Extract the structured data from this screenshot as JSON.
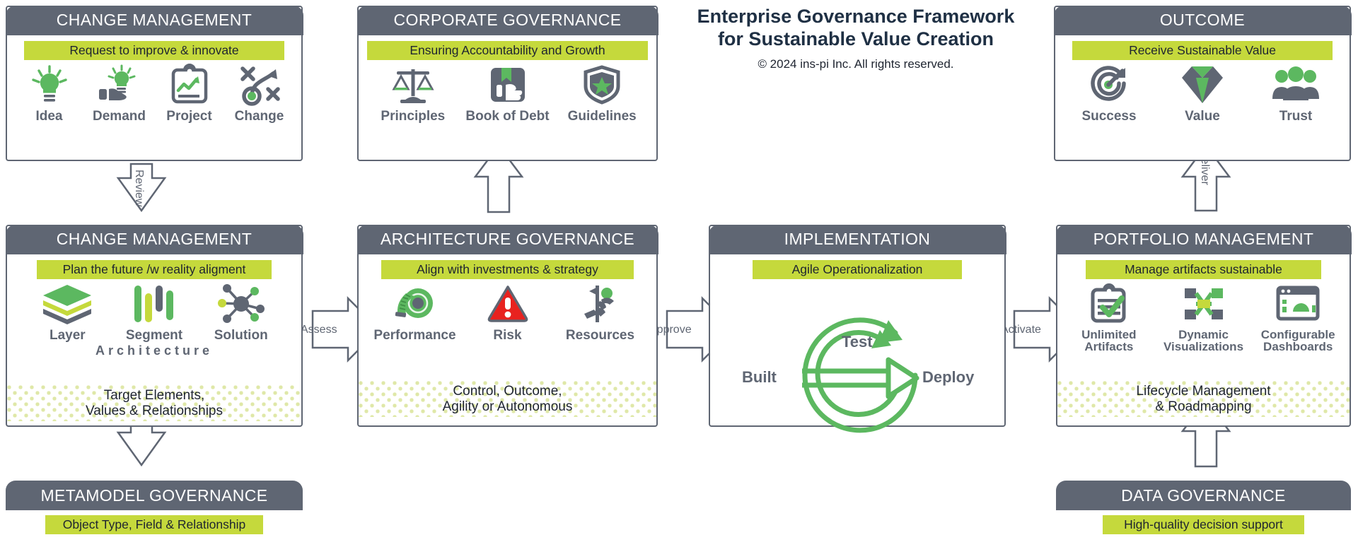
{
  "title": {
    "line1": "Enterprise Governance Framework",
    "line2": "for Sustainable Value Creation",
    "copyright": "© 2024 ins-pi Inc. All rights reserved."
  },
  "colors": {
    "slate": "#5f6673",
    "lime": "#c5d93c",
    "green": "#5cb860",
    "red": "#e8221f",
    "navy": "#1f3044",
    "dots": "#dfe8a8"
  },
  "cards": {
    "change_management_top": {
      "header": "CHANGE MANAGEMENT",
      "subtitle": "Request to improve & innovate",
      "icons": [
        {
          "label": "Idea",
          "icon": "lightbulb-icon"
        },
        {
          "label": "Demand",
          "icon": "hand-bulb-icon"
        },
        {
          "label": "Project",
          "icon": "clipboard-chart-icon"
        },
        {
          "label": "Change",
          "icon": "change-path-icon"
        }
      ]
    },
    "corporate_governance": {
      "header": "CORPORATE GOVERNANCE",
      "subtitle": "Ensuring Accountability and Growth",
      "icons": [
        {
          "label": "Principles",
          "icon": "scales-icon"
        },
        {
          "label": "Book of Debt",
          "icon": "book-thumb-icon"
        },
        {
          "label": "Guidelines",
          "icon": "shield-star-icon"
        }
      ]
    },
    "outcome": {
      "header": "OUTCOME",
      "subtitle": "Receive Sustainable Value",
      "icons": [
        {
          "label": "Success",
          "icon": "target-arrow-icon"
        },
        {
          "label": "Value",
          "icon": "diamond-icon"
        },
        {
          "label": "Trust",
          "icon": "people-group-icon"
        }
      ]
    },
    "change_management_mid": {
      "header": "CHANGE MANAGEMENT",
      "subtitle": "Plan the future /w reality aligment",
      "icons": [
        {
          "label": "Layer",
          "icon": "layers-icon"
        },
        {
          "label": "Segment",
          "icon": "bars-icon"
        },
        {
          "label": "Solution",
          "icon": "network-node-icon"
        }
      ],
      "group_label": "Architecture",
      "footer_line1": "Target Elements,",
      "footer_line2": "Values & Relationships"
    },
    "architecture_governance": {
      "header": "ARCHITECTURE GOVERNANCE",
      "subtitle": "Align with investments & strategy",
      "icons": [
        {
          "label": "Performance",
          "icon": "measuring-tape-icon"
        },
        {
          "label": "Risk",
          "icon": "warning-triangle-icon"
        },
        {
          "label": "Resources",
          "icon": "person-running-icon"
        }
      ],
      "footer_line1": "Control, Outcome,",
      "footer_line2": "Agility or Autonomous"
    },
    "implementation": {
      "header": "IMPLEMENTATION",
      "subtitle": "Agile Operationalization",
      "cycle": {
        "top": "Test",
        "left": "Built",
        "right": "Deploy"
      }
    },
    "portfolio_management": {
      "header": "PORTFOLIO MANAGEMENT",
      "subtitle": "Manage artifacts sustainable",
      "icons": [
        {
          "label": "Unlimited\nArtifacts",
          "label1": "Unlimited",
          "label2": "Artifacts",
          "icon": "clipboard-check-icon"
        },
        {
          "label": "Dynamic\nVisualizations",
          "label1": "Dynamic",
          "label2": "Visualizations",
          "icon": "flow-diagram-icon"
        },
        {
          "label": "Configurable\nDashboards",
          "label1": "Configurable",
          "label2": "Dashboards",
          "icon": "dashboard-icon"
        }
      ],
      "footer_line1": "Lifecycle Management",
      "footer_line2": "& Roadmapping"
    },
    "metamodel_governance": {
      "header": "METAMODEL GOVERNANCE",
      "subtitle": "Object Type, Field & Relationship"
    },
    "data_governance": {
      "header": "DATA GOVERNANCE",
      "subtitle": "High-quality decision support"
    }
  },
  "connectors": [
    {
      "label": "Review"
    },
    {
      "label": "Assess"
    },
    {
      "label": "Approve"
    },
    {
      "label": "Activate"
    },
    {
      "label": "Deliver"
    }
  ]
}
